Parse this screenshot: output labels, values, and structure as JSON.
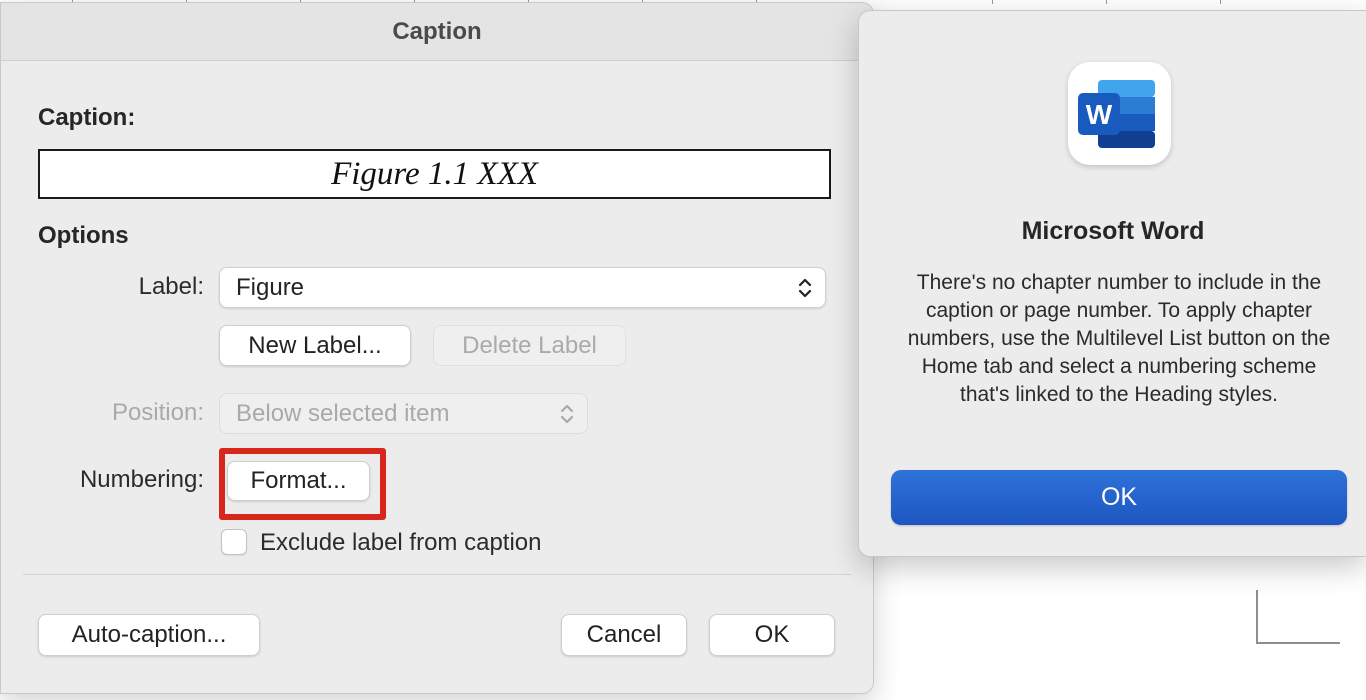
{
  "caption_dialog": {
    "title": "Caption",
    "caption_heading": "Caption:",
    "caption_value": "Figure 1.1 XXX",
    "options_heading": "Options",
    "label_label": "Label:",
    "label_value": "Figure",
    "new_label_button": "New Label...",
    "delete_label_button": "Delete Label",
    "position_label": "Position:",
    "position_value": "Below selected item",
    "numbering_label": "Numbering:",
    "format_button": "Format...",
    "exclude_label_checkbox": "Exclude label from caption",
    "exclude_label_checked": false,
    "auto_caption_button": "Auto-caption...",
    "cancel_button": "Cancel",
    "ok_button": "OK"
  },
  "alert": {
    "app_icon": "microsoft-word-icon",
    "icon_letter": "W",
    "title": "Microsoft Word",
    "message": "There's no chapter number to include in the caption or page number. To apply chapter numbers, use the Multilevel List button on the Home tab and select a numbering scheme that's linked to the Heading styles.",
    "ok_button": "OK"
  },
  "colors": {
    "highlight": "#d9261c",
    "accent_button": "#1d56c0",
    "word_blue": "#185abd"
  }
}
